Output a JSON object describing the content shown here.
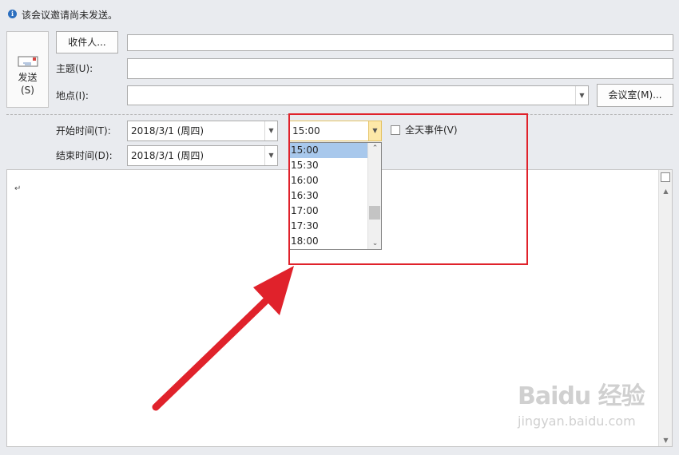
{
  "info_bar": {
    "icon": "info-icon",
    "text": "该会议邀请尚未发送。"
  },
  "send_button": {
    "label": "发送",
    "shortcut": "(S)",
    "icon": "envelope-icon"
  },
  "fields": {
    "recipients_button": "收件人...",
    "recipients_value": "",
    "subject_label": "主题(U):",
    "subject_value": "",
    "location_label": "地点(I):",
    "location_value": "",
    "room_button": "会议室(M)..."
  },
  "start": {
    "label": "开始时间(T):",
    "date": "2018/3/1 (周四)",
    "time": "15:00"
  },
  "end": {
    "label": "结束时间(D):",
    "date": "2018/3/1 (周四)"
  },
  "all_day": {
    "label": "全天事件(V)",
    "checked": false
  },
  "time_dropdown": {
    "options": [
      "15:00",
      "15:30",
      "16:00",
      "16:30",
      "17:00",
      "17:30",
      "18:00"
    ],
    "selected": "15:00"
  },
  "editor": {
    "paragraph_mark": "↵"
  },
  "watermark": {
    "line1": "Baidu 经验",
    "line2": "jingyan.baidu.com"
  },
  "colors": {
    "highlight": "#e0222b",
    "selected_item": "#a8c8ec",
    "accent": "#2c6fbf"
  }
}
